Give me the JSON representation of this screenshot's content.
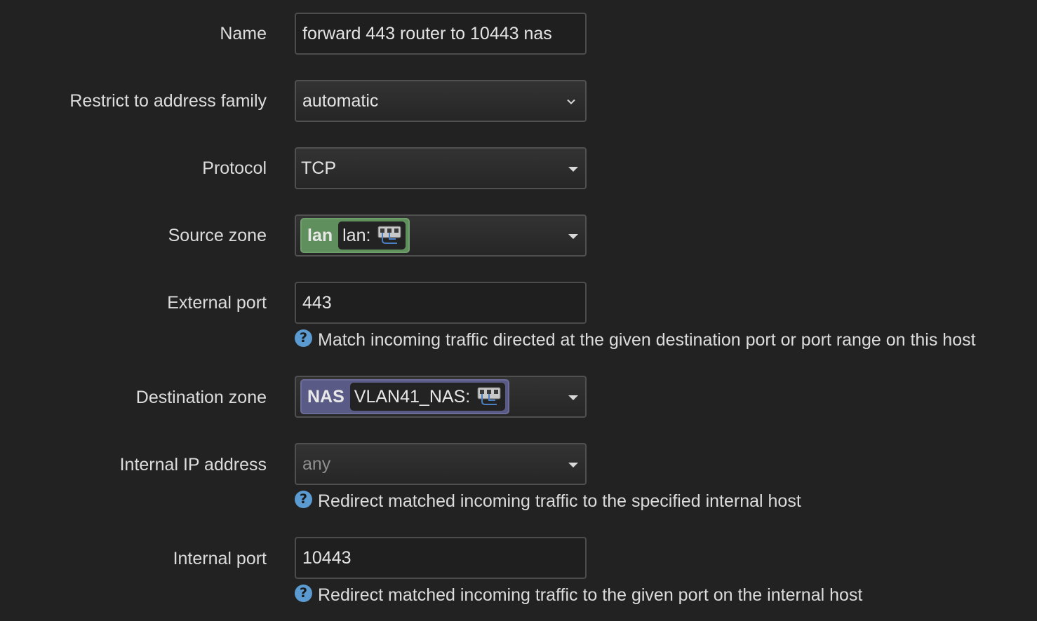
{
  "form": {
    "name": {
      "label": "Name",
      "value": "forward 443 router to 10443 nas"
    },
    "family": {
      "label": "Restrict to address family",
      "value": "automatic"
    },
    "protocol": {
      "label": "Protocol",
      "value": "TCP"
    },
    "source_zone": {
      "label": "Source zone",
      "zone": "lan",
      "network": "lan:",
      "color": "#5f8f5c",
      "icon": "network-port-icon"
    },
    "external_port": {
      "label": "External port",
      "value": "443",
      "help": "Match incoming traffic directed at the given destination port or port range on this host"
    },
    "dest_zone": {
      "label": "Destination zone",
      "zone": "NAS",
      "network": "VLAN41_NAS:",
      "color": "#5a5a86",
      "icon": "network-port-icon"
    },
    "internal_ip": {
      "label": "Internal IP address",
      "placeholder": "any",
      "help": "Redirect matched incoming traffic to the specified internal host"
    },
    "internal_port": {
      "label": "Internal port",
      "value": "10443",
      "help": "Redirect matched incoming traffic to the given port on the internal host"
    }
  },
  "help_icon_symbol": "?",
  "colors": {
    "background": "#222222",
    "help_icon": "#5b9bd1"
  }
}
